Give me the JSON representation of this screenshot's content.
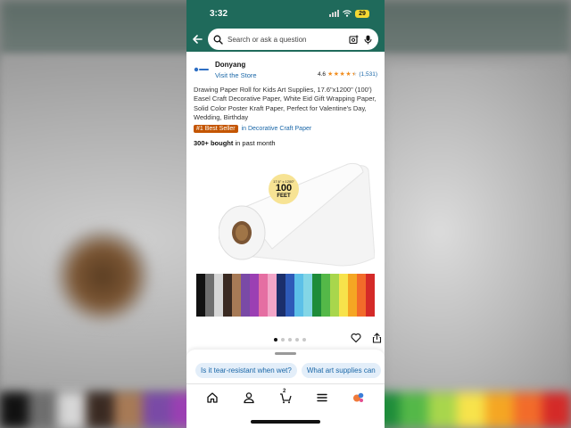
{
  "status_bar": {
    "time": "3:32",
    "battery": "29"
  },
  "search": {
    "placeholder": "Search or ask a question"
  },
  "brand": {
    "name": "Donyang",
    "visit_store": "Visit the Store"
  },
  "rating": {
    "value": "4.6",
    "stars": 4.5,
    "count": "(1,531)"
  },
  "product": {
    "title": "Drawing Paper Roll for Kids Art Supplies, 17.6\"x1200\" (100') Easel Craft Decorative Paper, White Eid Gift Wrapping Paper, Solid Color Poster Kraft Paper, Perfect for Valentine's Day, Wedding, Birthday",
    "badge": "#1 Best Seller",
    "category": "in Decorative Craft Paper",
    "bought_bold": "300+ bought",
    "bought_rest": " in past month"
  },
  "image": {
    "size_small": "17.6\" x 1200\"",
    "size_big": "100",
    "size_unit": "FEET",
    "dot_count": 5,
    "active_dot": 0,
    "swatch_colors": [
      "#111111",
      "#6e6e6e",
      "#d6d6d6",
      "#3a2a22",
      "#a77a56",
      "#7a4aa6",
      "#9b3fb3",
      "#e56ea2",
      "#f2a6c8",
      "#1b2f6b",
      "#2e5ab8",
      "#5cc0e8",
      "#83d6e6",
      "#1e8c3a",
      "#54b848",
      "#a8d64c",
      "#f7e34b",
      "#f5a623",
      "#f26b2a",
      "#d42a28"
    ]
  },
  "ask_chips": [
    "Is it tear-resistant when wet?",
    "What art supplies can"
  ],
  "nav": {
    "cart_count": "2",
    "items": [
      "home-icon",
      "account-icon",
      "cart-icon",
      "menu-icon",
      "rufus-icon"
    ]
  },
  "colors": {
    "header": "#1f6a5b",
    "link": "#1a67a8",
    "badge": "#c45500",
    "star": "#f18d1f"
  }
}
